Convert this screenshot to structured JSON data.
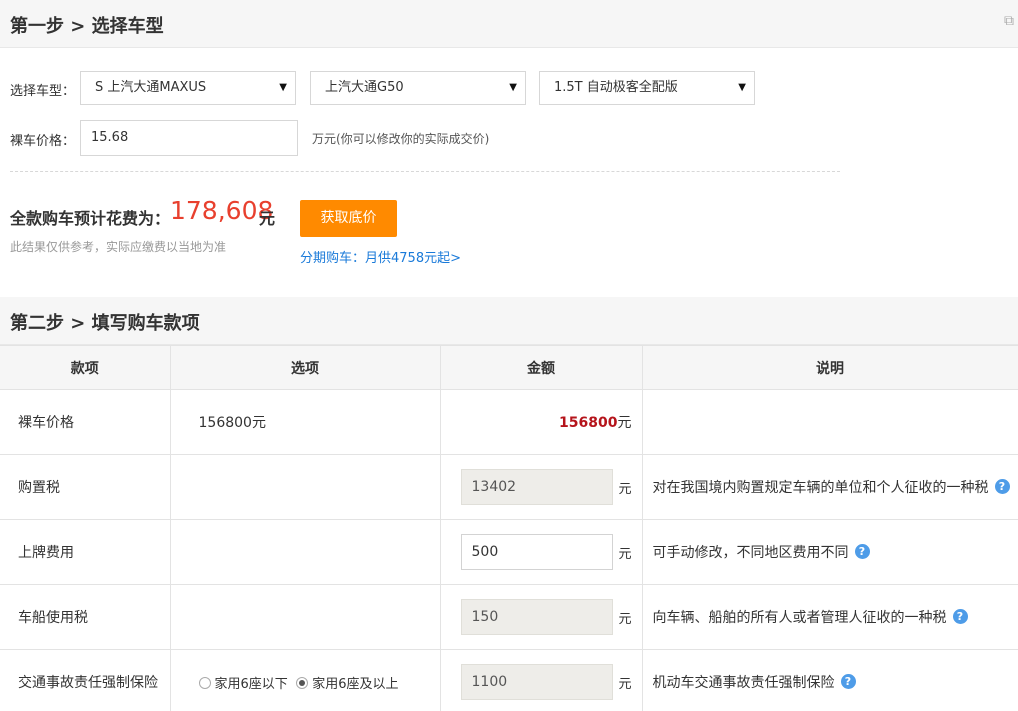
{
  "step1": {
    "title": "第一步 > 选择车型",
    "select_label": "选择车型：",
    "brand": "S 上汽大通MAXUS",
    "series": "上汽大通G50",
    "model": "1.5T 自动极客全配版",
    "price_label": "裸车价格：",
    "price_value": "15.68",
    "price_hint": "万元(你可以修改你的实际成交价)",
    "total_label": "全款购车预计花费为：",
    "total_value": "178,608",
    "total_unit": "元",
    "disclaimer": "此结果仅供参考，实际应缴费以当地为准",
    "get_price_button": "获取底价",
    "installment_link": "分期购车：月供4758元起>"
  },
  "step2": {
    "title": "第二步 > 填写购车款项",
    "columns": [
      "款项",
      "选项",
      "金额",
      "说明"
    ],
    "rows": [
      {
        "item": "裸车价格",
        "option": "156800元",
        "amount": "156800",
        "amount_unit": "元",
        "desc": ""
      },
      {
        "item": "购置税",
        "option": "",
        "amount": "13402",
        "amount_unit": "元",
        "desc": "对在我国境内购置规定车辆的单位和个人征收的一种税"
      },
      {
        "item": "上牌费用",
        "option": "",
        "amount": "500",
        "amount_unit": "元",
        "desc": "可手动修改，不同地区费用不同"
      },
      {
        "item": "车船使用税",
        "option": "",
        "amount": "150",
        "amount_unit": "元",
        "desc": "向车辆、船舶的所有人或者管理人征收的一种税"
      },
      {
        "item": "交通事故责任强制保险",
        "option_a": "家用6座以下",
        "option_b": "家用6座及以上",
        "amount": "1100",
        "amount_unit": "元",
        "desc": "机动车交通事故责任强制保险"
      }
    ]
  },
  "icons": {
    "help": "?",
    "dropdown": "▼",
    "share": "⧉"
  }
}
